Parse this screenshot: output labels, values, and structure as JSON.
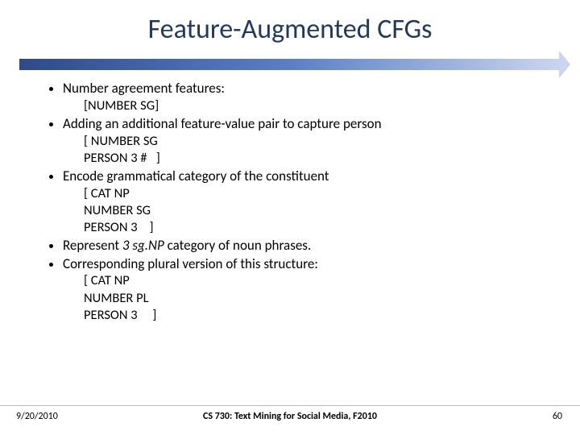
{
  "title": "Feature-Augmented CFGs",
  "bullets": {
    "b1": "Number agreement features:",
    "b1_sub1": "[NUMBER SG]",
    "b2": "Adding an additional feature-value pair to capture person",
    "b2_sub1": "[ NUMBER SG",
    "b2_sub2": "PERSON 3 #   ]",
    "b3": "Encode grammatical category of the constituent",
    "b3_sub1": "[ CAT NP",
    "b3_sub2": "NUMBER SG",
    "b3_sub3": "PERSON 3    ]",
    "b4_pre": "Represent ",
    "b4_ital": "3 sg.NP",
    "b4_post": " category of noun phrases.",
    "b5": "Corresponding plural version of this structure:",
    "b5_sub1": "[ CAT NP",
    "b5_sub2": "NUMBER PL",
    "b5_sub3": "PERSON 3     ]"
  },
  "footer": {
    "date": "9/20/2010",
    "course": "CS 730: Text Mining for Social Media, F2010",
    "page": "60"
  }
}
